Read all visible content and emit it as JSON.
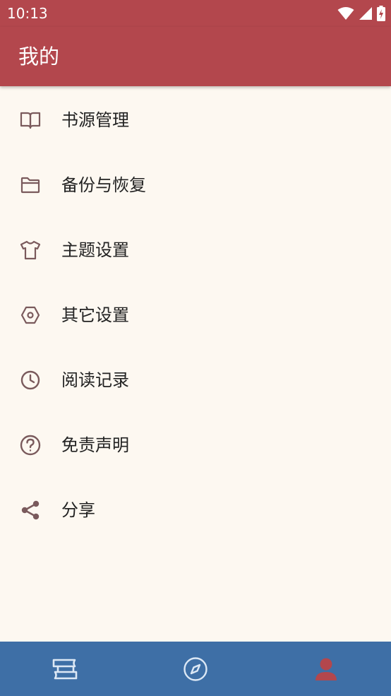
{
  "status_bar": {
    "time": "10:13"
  },
  "header": {
    "title": "我的"
  },
  "menu": {
    "items": [
      {
        "label": "书源管理",
        "icon": "book-open-icon"
      },
      {
        "label": "备份与恢复",
        "icon": "folder-icon"
      },
      {
        "label": "主题设置",
        "icon": "shirt-icon"
      },
      {
        "label": "其它设置",
        "icon": "hexagon-icon"
      },
      {
        "label": "阅读记录",
        "icon": "clock-icon"
      },
      {
        "label": "免责声明",
        "icon": "question-circle-icon"
      },
      {
        "label": "分享",
        "icon": "share-icon"
      }
    ]
  },
  "bottom_nav": {
    "tabs": [
      {
        "icon": "bookshelf-icon",
        "selected": false
      },
      {
        "icon": "compass-icon",
        "selected": false
      },
      {
        "icon": "person-icon",
        "selected": true
      }
    ]
  },
  "colors": {
    "header": "#b3474d",
    "background": "#fdf8f1",
    "bottom_nav": "#3e6fa6",
    "menu_icon": "#7a5a5c",
    "nav_active": "#b3474d",
    "nav_inactive": "#dce8f5"
  }
}
